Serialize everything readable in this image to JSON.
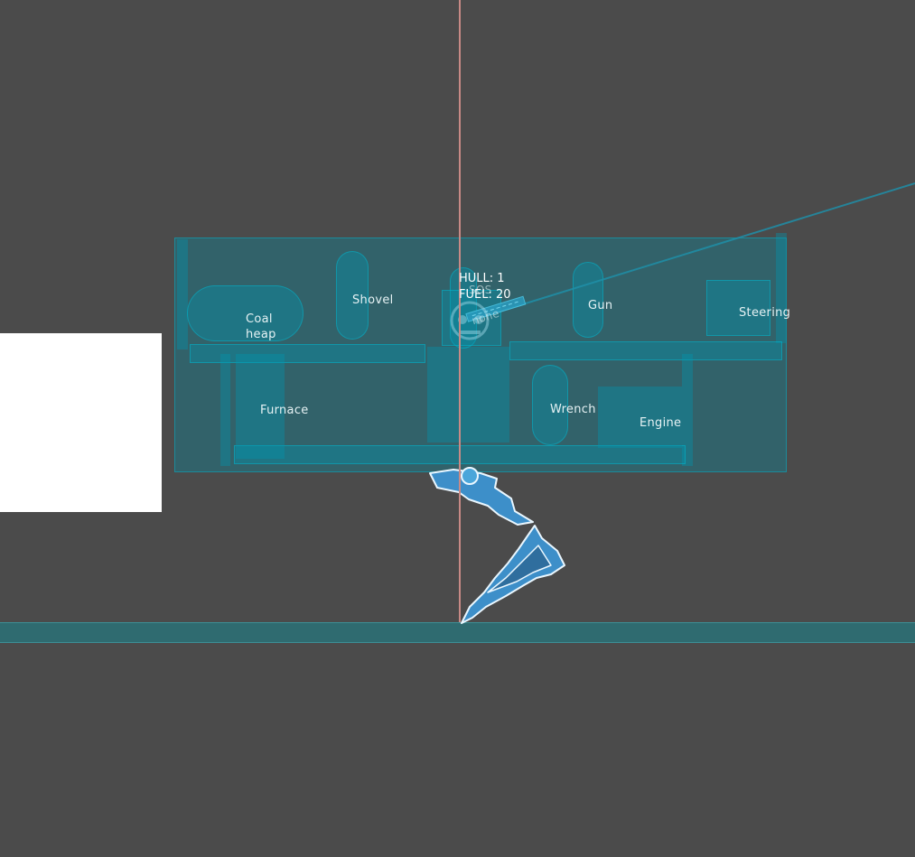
{
  "hud": {
    "hull": "HULL: 1",
    "fuel": "FUEL: 20"
  },
  "stations": {
    "coal_heap_line1": "Coal",
    "coal_heap_line2": "heap",
    "shovel": "Shovel",
    "sos": "SOS",
    "none": "none",
    "gun": "Gun",
    "steering": "Steering",
    "furnace": "Furnace",
    "wrench": "Wrench",
    "engine": "Engine"
  },
  "colors": {
    "background": "#4b4b4b",
    "collision_shape": "#0096af",
    "leg_outline": "#e8f6ff",
    "leg_fill": "#3d8fc9",
    "vertical_guide": "#c88a86"
  }
}
